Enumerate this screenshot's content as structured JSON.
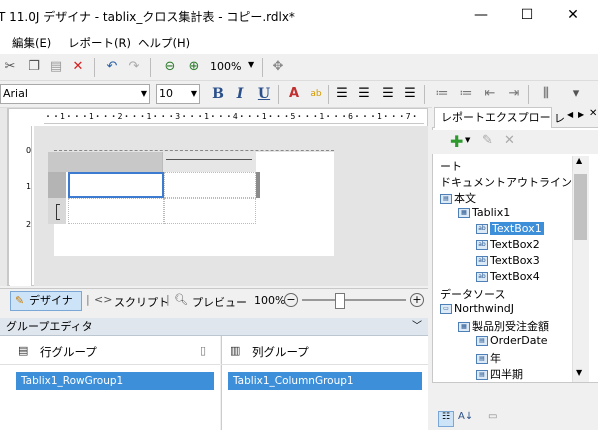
{
  "window": {
    "title": "T 11.0J デザイナ - tablix_クロス集計表 - コピー.rdlx*",
    "minimize_glyph": "—",
    "maximize_glyph": "☐",
    "close_glyph": "✕"
  },
  "menu": {
    "items": [
      "編集(E)",
      "レポート(R)",
      "ヘルプ(H)"
    ]
  },
  "toolbar1": {
    "zoom_value": "100%"
  },
  "toolbar2": {
    "font_name": "Arial",
    "font_size": "10",
    "bold": "B",
    "italic": "I",
    "underline": "U"
  },
  "designer": {
    "ruler_text": "・・1・・・1・・・2・・・1・・・3・・・1・・・4・・・1・・・5・・・1・・・6・・・1・・・7・",
    "vruler_marks": [
      "0",
      "1",
      "2"
    ]
  },
  "viewbar": {
    "designer_label": "デザイナ",
    "script_label": "スクリプト",
    "preview_label": "プレビュー",
    "zoom": "100%",
    "zoom_out": "−",
    "zoom_in": "+",
    "zoom_level": 0.4
  },
  "group_editor": {
    "title": "グループエディタ",
    "row_title": "行グループ",
    "col_title": "列グループ",
    "row_group": "Tablix1_RowGroup1",
    "col_group": "Tablix1_ColumnGroup1"
  },
  "report_explorer": {
    "tab_label": "レポートエクスプローラ",
    "tab2_label": "レ",
    "tree": [
      {
        "label": "ート",
        "indent": 0,
        "icon": "none"
      },
      {
        "label": "ドキュメントアウトライン",
        "indent": 0,
        "icon": "none"
      },
      {
        "label": "本文",
        "indent": 0,
        "icon": "doc"
      },
      {
        "label": "Tablix1",
        "indent": 1,
        "icon": "grid"
      },
      {
        "label": "TextBox1",
        "indent": 2,
        "icon": "abl",
        "selected": true
      },
      {
        "label": "TextBox2",
        "indent": 2,
        "icon": "abl"
      },
      {
        "label": "TextBox3",
        "indent": 2,
        "icon": "abl"
      },
      {
        "label": "TextBox4",
        "indent": 2,
        "icon": "abl"
      },
      {
        "label": "データソース",
        "indent": 0,
        "icon": "none"
      },
      {
        "label": "NorthwindJ",
        "indent": 0,
        "icon": "db"
      },
      {
        "label": "製品別受注金額",
        "indent": 1,
        "icon": "grid"
      },
      {
        "label": "OrderDate",
        "indent": 2,
        "icon": "field"
      },
      {
        "label": "年",
        "indent": 2,
        "icon": "field"
      },
      {
        "label": "四半期",
        "indent": 2,
        "icon": "field"
      }
    ]
  }
}
